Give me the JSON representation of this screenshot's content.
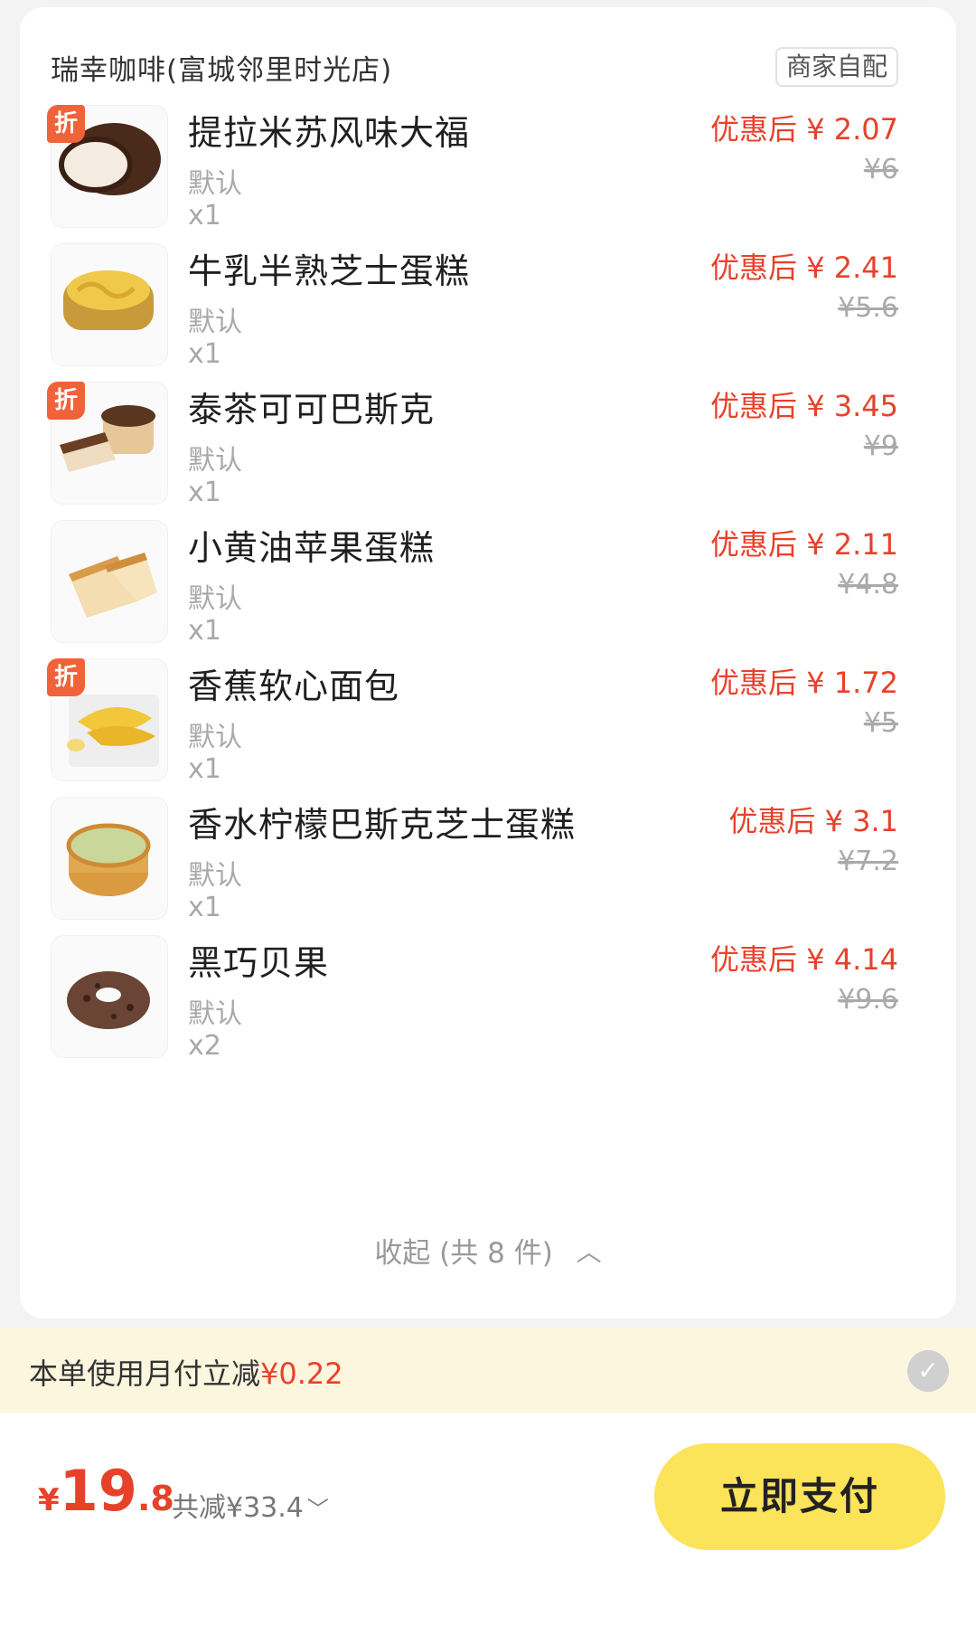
{
  "store": {
    "name": "瑞幸咖啡(富城邻里时光店)",
    "delivery": "商家自配"
  },
  "items": [
    {
      "name": "提拉米苏风味大福",
      "spec": "默认",
      "qty": "x1",
      "price_now": "优惠后 ¥ 2.07",
      "price_orig": "¥6",
      "tag": "折"
    },
    {
      "name": "牛乳半熟芝士蛋糕",
      "spec": "默认",
      "qty": "x1",
      "price_now": "优惠后 ¥ 2.41",
      "price_orig": "¥5.6",
      "tag": ""
    },
    {
      "name": "泰茶可可巴斯克",
      "spec": "默认",
      "qty": "x1",
      "price_now": "优惠后 ¥ 3.45",
      "price_orig": "¥9",
      "tag": "折"
    },
    {
      "name": "小黄油苹果蛋糕",
      "spec": "默认",
      "qty": "x1",
      "price_now": "优惠后 ¥ 2.11",
      "price_orig": "¥4.8",
      "tag": ""
    },
    {
      "name": "香蕉软心面包",
      "spec": "默认",
      "qty": "x1",
      "price_now": "优惠后 ¥ 1.72",
      "price_orig": "¥5",
      "tag": "折"
    },
    {
      "name": "香水柠檬巴斯克芝士蛋糕",
      "spec": "默认",
      "qty": "x1",
      "price_now": "优惠后 ¥ 3.1",
      "price_orig": "¥7.2",
      "tag": ""
    },
    {
      "name": "黑巧贝果",
      "spec": "默认",
      "qty": "x2",
      "price_now": "优惠后 ¥ 4.14",
      "price_orig": "¥9.6",
      "tag": ""
    }
  ],
  "collapse": {
    "label": "收起 (共 8 件)",
    "icon": "chevron-up-icon"
  },
  "promo": {
    "text": "本单使用月付立减",
    "amount": "¥0.22",
    "icon": "check-circle-icon"
  },
  "total": {
    "currency": "¥",
    "int_part": "19",
    "dec_part": ".8",
    "saved": "共减¥33.4",
    "saved_icon": "chevron-down-icon"
  },
  "pay_button": {
    "label": "立即支付"
  },
  "colors": {
    "price_red": "#e8412a",
    "pay_yellow": "#fbe35a",
    "promo_bg": "#fdf6de",
    "tag_orange": "#f0623a"
  }
}
